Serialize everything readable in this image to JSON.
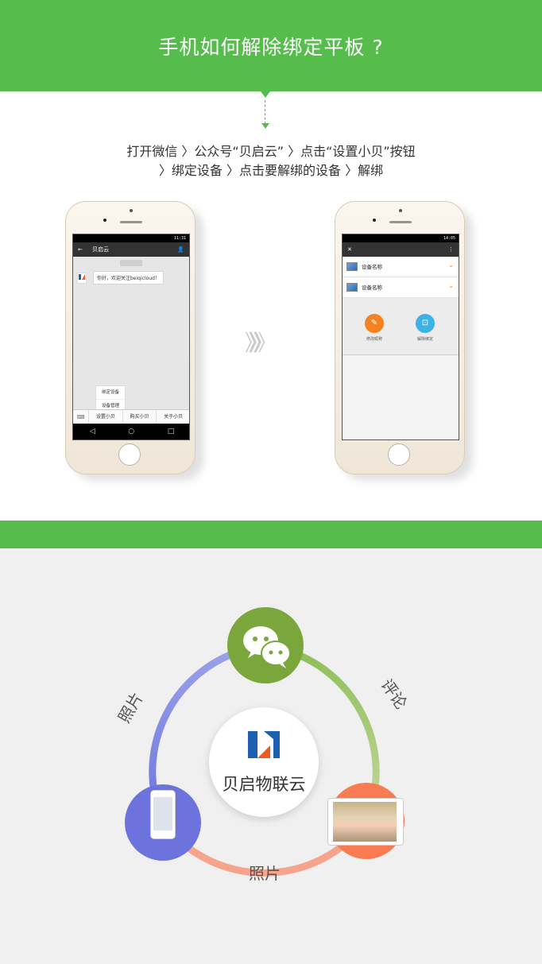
{
  "banner": {
    "title": "手机如何解除绑定平板 ?"
  },
  "steps": {
    "line1": "打开微信 〉公众号“贝启云” 〉点击“设置小贝”按钮",
    "line2": "〉绑定设备 〉点击要解绑的设备 〉解绑"
  },
  "phone1": {
    "status_time": "11:31",
    "title": "贝启云",
    "back_icon": "←",
    "user_icon": "👤",
    "chat_avatar": "贝启云",
    "chat_message": "你好，欢迎关注beiqicloud！",
    "menu_popup": [
      "绑定设备",
      "设备管理"
    ],
    "menu_bar": [
      "设置小贝",
      "购买小贝",
      "关于小贝"
    ],
    "nav_icons": [
      "◁",
      "○",
      "□"
    ]
  },
  "phone2": {
    "status_time": "14:05",
    "close_icon": "✕",
    "more_icon": "⋮",
    "devices": [
      {
        "name": "设备名称"
      },
      {
        "name": "设备名称"
      }
    ],
    "actions": [
      {
        "label": "修改昵称",
        "color": "#f58220"
      },
      {
        "label": "解除绑定",
        "color": "#3cb3e6"
      }
    ]
  },
  "arrows": "》》》",
  "diagram": {
    "center_name": "贝启物联云",
    "label_top_left": "照片",
    "label_top_right": "评论",
    "label_bottom": "照片",
    "colors": {
      "chat": "#7ba63b",
      "phone": "#6d73dc",
      "photo": "#f87b52",
      "green": "#56bd4c"
    }
  }
}
